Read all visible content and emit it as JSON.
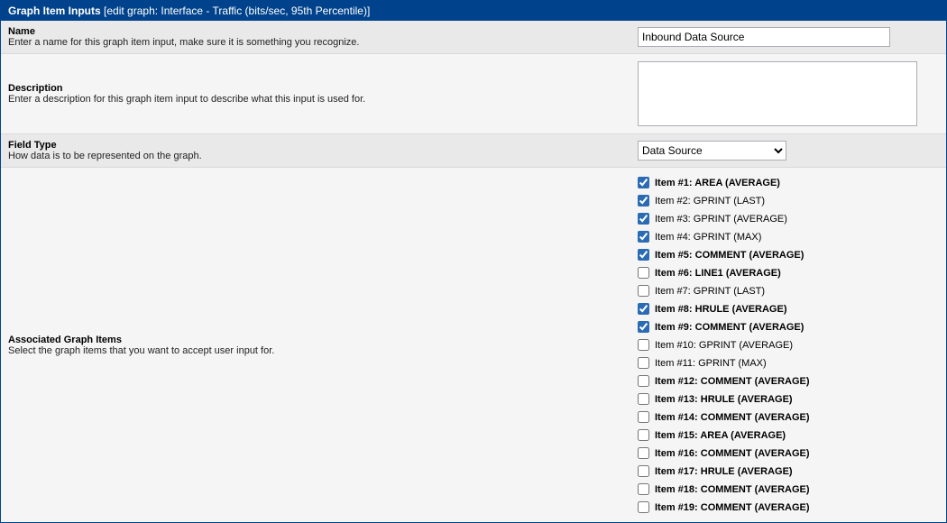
{
  "header": {
    "title": "Graph Item Inputs",
    "subtitle": "[edit graph: Interface - Traffic (bits/sec, 95th Percentile)]"
  },
  "fields": {
    "name": {
      "label": "Name",
      "desc": "Enter a name for this graph item input, make sure it is something you recognize.",
      "value": "Inbound Data Source"
    },
    "description": {
      "label": "Description",
      "desc": "Enter a description for this graph item input to describe what this input is used for.",
      "value": ""
    },
    "field_type": {
      "label": "Field Type",
      "desc": "How data is to be represented on the graph.",
      "value": "Data Source"
    },
    "associated": {
      "label": "Associated Graph Items",
      "desc": "Select the graph items that you want to accept user input for."
    }
  },
  "items": [
    {
      "label": "Item #1: AREA (AVERAGE)",
      "checked": true,
      "bold": true
    },
    {
      "label": "Item #2: GPRINT (LAST)",
      "checked": true,
      "bold": false
    },
    {
      "label": "Item #3: GPRINT (AVERAGE)",
      "checked": true,
      "bold": false
    },
    {
      "label": "Item #4: GPRINT (MAX)",
      "checked": true,
      "bold": false
    },
    {
      "label": "Item #5: COMMENT (AVERAGE)",
      "checked": true,
      "bold": true
    },
    {
      "label": "Item #6: LINE1 (AVERAGE)",
      "checked": false,
      "bold": true
    },
    {
      "label": "Item #7: GPRINT (LAST)",
      "checked": false,
      "bold": false
    },
    {
      "label": "Item #8: HRULE (AVERAGE)",
      "checked": true,
      "bold": true
    },
    {
      "label": "Item #9: COMMENT (AVERAGE)",
      "checked": true,
      "bold": true
    },
    {
      "label": "Item #10: GPRINT (AVERAGE)",
      "checked": false,
      "bold": false
    },
    {
      "label": "Item #11: GPRINT (MAX)",
      "checked": false,
      "bold": false
    },
    {
      "label": "Item #12: COMMENT (AVERAGE)",
      "checked": false,
      "bold": true
    },
    {
      "label": "Item #13: HRULE (AVERAGE)",
      "checked": false,
      "bold": true
    },
    {
      "label": "Item #14: COMMENT (AVERAGE)",
      "checked": false,
      "bold": true
    },
    {
      "label": "Item #15: AREA (AVERAGE)",
      "checked": false,
      "bold": true
    },
    {
      "label": "Item #16: COMMENT (AVERAGE)",
      "checked": false,
      "bold": true
    },
    {
      "label": "Item #17: HRULE (AVERAGE)",
      "checked": false,
      "bold": true
    },
    {
      "label": "Item #18: COMMENT (AVERAGE)",
      "checked": false,
      "bold": true
    },
    {
      "label": "Item #19: COMMENT (AVERAGE)",
      "checked": false,
      "bold": true
    }
  ]
}
